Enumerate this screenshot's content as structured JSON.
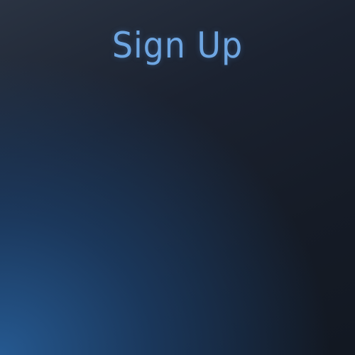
{
  "header": {
    "title": "Sign Up"
  },
  "colors": {
    "title": "#6ea6e2",
    "background_dark": "#151b26",
    "background_glow": "#265c96"
  }
}
